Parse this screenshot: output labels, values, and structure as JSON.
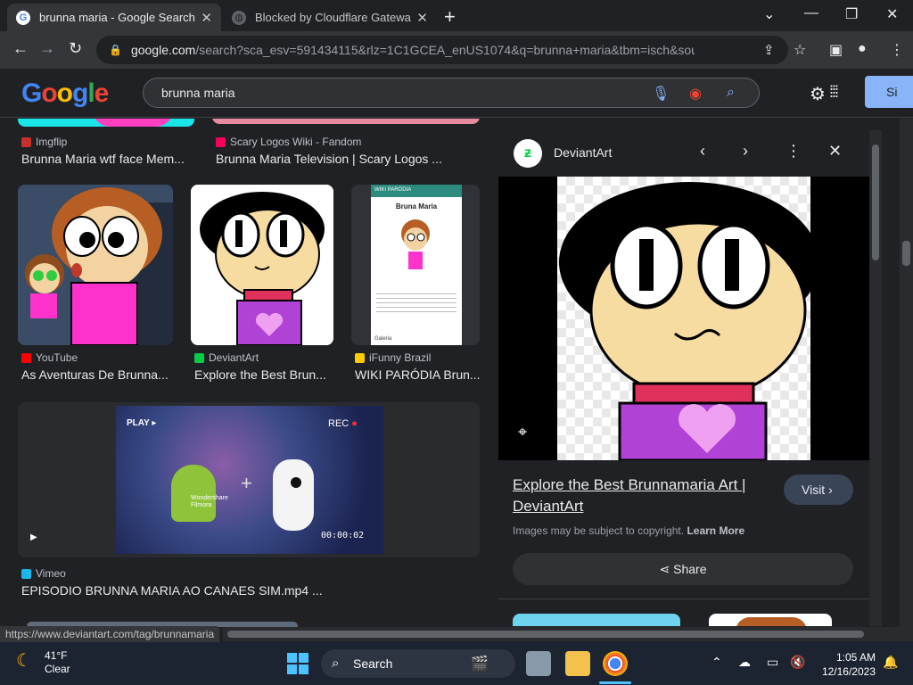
{
  "browser": {
    "tabs": [
      {
        "title": "brunna maria - Google Search",
        "active": true
      },
      {
        "title": "Blocked by Cloudflare Gateway",
        "active": false
      }
    ],
    "url_host": "google.com",
    "url_rest": "/search?sca_esv=591434115&rlz=1C1GCEA_enUS1074&q=brunna+maria&tbm=isch&source=lnms...",
    "status_url": "https://www.deviantart.com/tag/brunnamaria"
  },
  "google": {
    "logo": "Google",
    "query": "brunna maria",
    "signin": "Si"
  },
  "results": [
    {
      "source": "Imgflip",
      "title": "Brunna Maria wtf face Mem...",
      "color": "#c9302c"
    },
    {
      "source": "Scary Logos Wiki - Fandom",
      "title": "Brunna Maria Television | Scary Logos ...",
      "color": "#fa005a"
    },
    {
      "source": "YouTube",
      "title": "As Aventuras De Brunna...",
      "color": "#ff0000"
    },
    {
      "source": "DeviantArt",
      "title": "Explore the Best Brun...",
      "color": "#05cc47"
    },
    {
      "source": "iFunny Brazil",
      "title": "WIKI PARÓDIA Brun...",
      "color": "#ffcc00"
    },
    {
      "source": "Vimeo",
      "title": "EPISODIO BRUNNA MARIA AO CANAES SIM.mp4 ...",
      "color": "#1ab7ea"
    }
  ],
  "wiki_card": {
    "header": "WIKI PARÓDIA",
    "name": "Bruna Maria",
    "footer": "Galeria"
  },
  "video": {
    "play": "PLAY ▸",
    "rec": "REC",
    "time": "00:00:02",
    "brand": "Wondershare Filmora"
  },
  "panel": {
    "source": "DeviantArt",
    "title": "Explore the Best Brunnamaria Art | DeviantArt",
    "visit": "Visit",
    "copyright": "Images may be subject to copyright.",
    "learn_more": "Learn More",
    "share": "Share"
  },
  "taskbar": {
    "temp": "41°F",
    "cond": "Clear",
    "search": "Search",
    "time": "1:05 AM",
    "date": "12/16/2023"
  }
}
